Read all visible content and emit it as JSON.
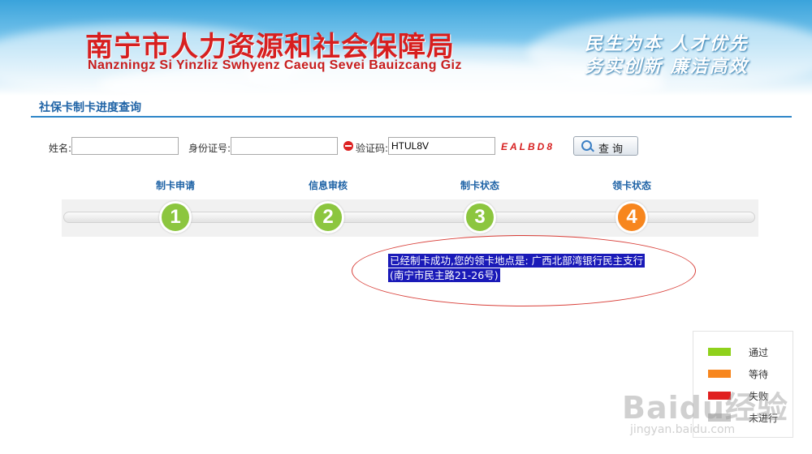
{
  "header": {
    "org_name_cn": "南宁市人力资源和社会保障局",
    "org_name_za": "Nanzningz Si Yinzliz  Swhyenz Caeuq Sevei Bauizcang Giz",
    "slogan_line1": "民生为本  人才优先",
    "slogan_line2": "务实创新  廉洁高效"
  },
  "section": {
    "title": "社保卡制卡进度查询"
  },
  "form": {
    "name_label": "姓名:",
    "name_value": "",
    "id_label": "身份证号:",
    "id_value": "",
    "captcha_label": "验证码:",
    "captcha_value": "HTUL8V",
    "captcha_image_text": "EALBD8",
    "query_button_label": "查询"
  },
  "steps": [
    {
      "number": "1",
      "label": "制卡申请",
      "color": "#8cc63f"
    },
    {
      "number": "2",
      "label": "信息审核",
      "color": "#8cc63f"
    },
    {
      "number": "3",
      "label": "制卡状态",
      "color": "#8cc63f"
    },
    {
      "number": "4",
      "label": "领卡状态",
      "color": "#f7861e"
    }
  ],
  "result": {
    "line1": "已经制卡成功,您的领卡地点是: 广西北部湾银行民主支行",
    "line2": "(南宁市民主路21-26号)"
  },
  "legend": [
    {
      "label": "通过",
      "color": "#8fd11c"
    },
    {
      "label": "等待",
      "color": "#f7861e"
    },
    {
      "label": "失败",
      "color": "#e02020"
    },
    {
      "label": "未进行",
      "color": "#c8c8c8"
    }
  ],
  "watermark": {
    "text": "Baidu经验",
    "sub": "jingyan.baidu.com"
  }
}
